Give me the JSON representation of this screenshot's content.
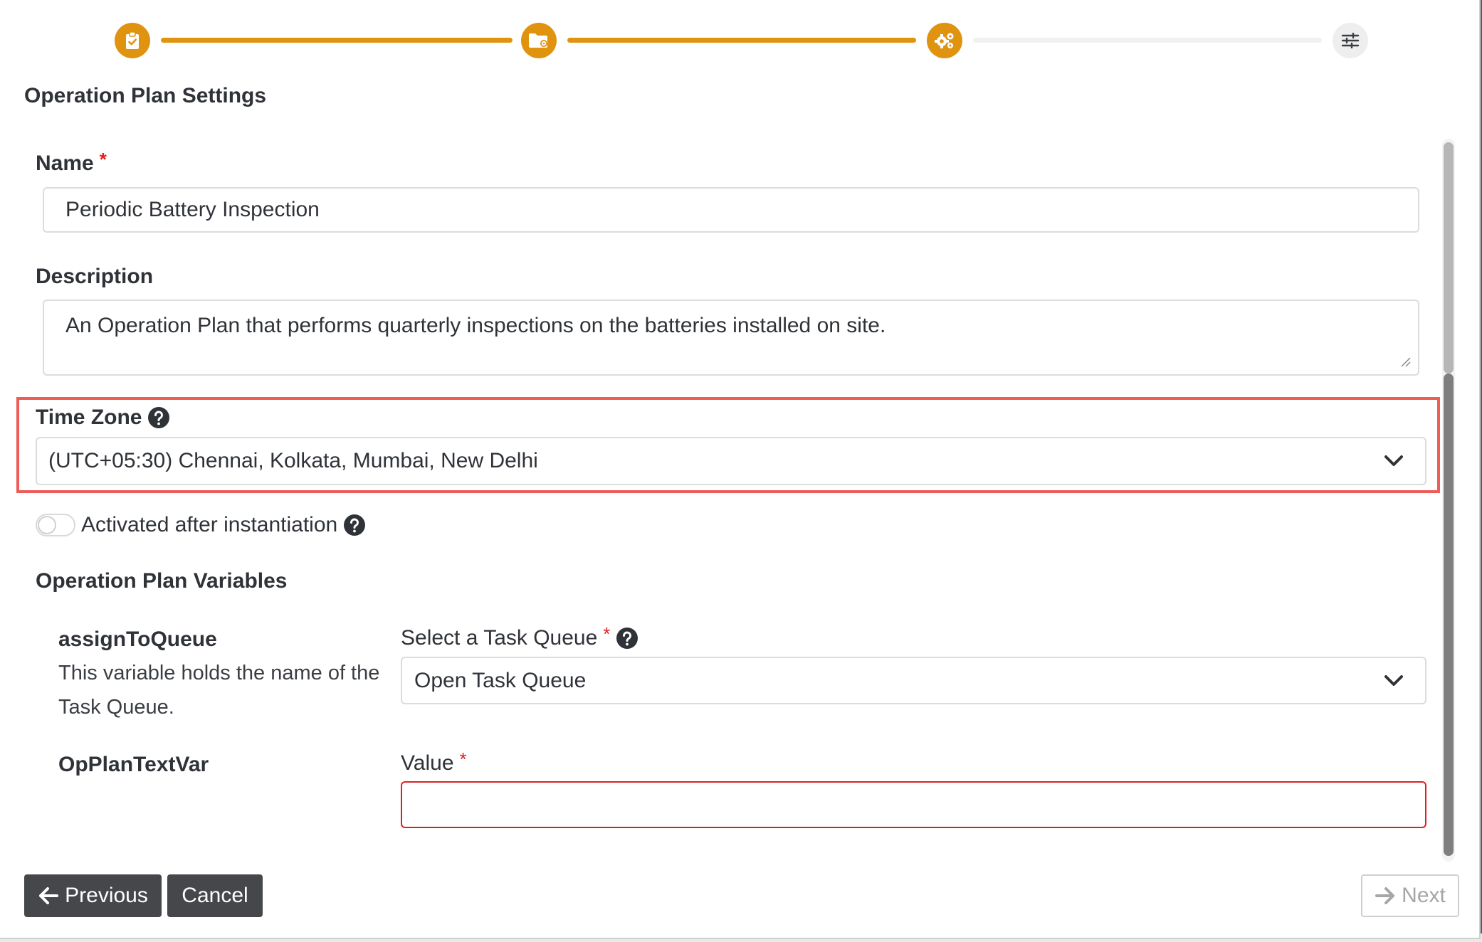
{
  "stepper": {
    "steps": [
      {
        "icon": "clipboard-check-icon",
        "state": "complete"
      },
      {
        "icon": "folder-gear-icon",
        "state": "complete"
      },
      {
        "icon": "gears-icon",
        "state": "current"
      },
      {
        "icon": "sliders-icon",
        "state": "pending"
      }
    ]
  },
  "form": {
    "title": "Operation Plan Settings",
    "name": {
      "label": "Name",
      "required_mark": "*",
      "value": "Periodic Battery Inspection"
    },
    "description": {
      "label": "Description",
      "value": "An Operation Plan that performs quarterly inspections on the batteries installed on site."
    },
    "timezone": {
      "label": "Time Zone",
      "value": "(UTC+05:30) Chennai, Kolkata, Mumbai, New Delhi"
    },
    "activated": {
      "label": "Activated after instantiation",
      "on": false
    },
    "variables": {
      "title": "Operation Plan Variables",
      "items": [
        {
          "name": "assignToQueue",
          "description": "This variable holds the name of the Task Queue.",
          "field_label": "Select a Task Queue",
          "required_mark": "*",
          "value": "Open Task Queue"
        },
        {
          "name": "OpPlanTextVar",
          "description": "",
          "field_label": "Value",
          "required_mark": "*",
          "value": ""
        }
      ]
    }
  },
  "footer": {
    "previous_label": "Previous",
    "cancel_label": "Cancel",
    "next_label": "Next"
  },
  "colors": {
    "accent": "#e0930f",
    "highlight": "#ee5c57",
    "error": "#e0201f",
    "button_dark": "#45474a"
  }
}
